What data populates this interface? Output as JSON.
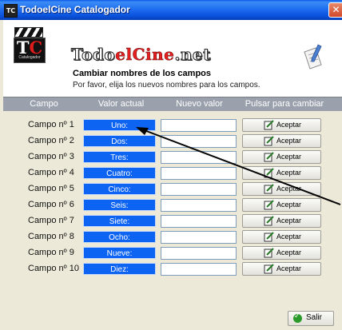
{
  "window": {
    "title": "TodoelCine Catalogador",
    "app_icon_text": "TC",
    "close_symbol": "✕"
  },
  "header": {
    "logo_initials": "T",
    "logo_initials_accent": "C",
    "logo_sub": "Catalogador",
    "brand_part1": "Todo",
    "brand_part2": "el",
    "brand_part3": "Cine",
    "brand_part4": ".net",
    "section_title": "Cambiar nombres de los campos",
    "section_desc": "Por favor, elija los nuevos nombres para los campos.",
    "doc_icon": "document-pencil-icon"
  },
  "columns": {
    "campo": "Campo",
    "valor_actual": "Valor actual",
    "nuevo_valor": "Nuevo valor",
    "pulsar": "Pulsar para cambiar"
  },
  "rows": [
    {
      "label": "Campo nº 1",
      "current": "Uno:",
      "new_value": "",
      "button": "Aceptar"
    },
    {
      "label": "Campo nº 2",
      "current": "Dos:",
      "new_value": "",
      "button": "Aceptar"
    },
    {
      "label": "Campo nº 3",
      "current": "Tres:",
      "new_value": "",
      "button": "Aceptar"
    },
    {
      "label": "Campo nº 4",
      "current": "Cuatro:",
      "new_value": "",
      "button": "Aceptar"
    },
    {
      "label": "Campo nº 5",
      "current": "Cinco:",
      "new_value": "",
      "button": "Aceptar"
    },
    {
      "label": "Campo nº 6",
      "current": "Seis:",
      "new_value": "",
      "button": "Aceptar"
    },
    {
      "label": "Campo nº 7",
      "current": "Siete:",
      "new_value": "",
      "button": "Aceptar"
    },
    {
      "label": "Campo nº 8",
      "current": "Ocho:",
      "new_value": "",
      "button": "Aceptar"
    },
    {
      "label": "Campo nº 9",
      "current": "Nueve:",
      "new_value": "",
      "button": "Aceptar"
    },
    {
      "label": "Campo nº 10",
      "current": "Diez:",
      "new_value": "",
      "button": "Aceptar"
    }
  ],
  "footer": {
    "salir_label": "Salir"
  },
  "colors": {
    "title_bar": "#0a52dc",
    "current_value_bg": "#0d63f2",
    "column_header_bg": "#9aa1ad",
    "window_bg": "#ece9d8"
  }
}
